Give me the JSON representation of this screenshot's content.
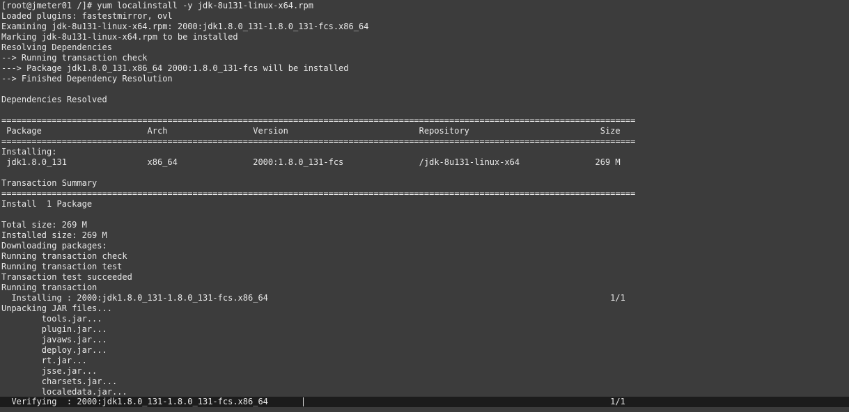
{
  "terminal": {
    "lines": [
      "[root@jmeter01 /]# yum localinstall -y jdk-8u131-linux-x64.rpm",
      "Loaded plugins: fastestmirror, ovl",
      "Examining jdk-8u131-linux-x64.rpm: 2000:jdk1.8.0_131-1.8.0_131-fcs.x86_64",
      "Marking jdk-8u131-linux-x64.rpm to be installed",
      "Resolving Dependencies",
      "--> Running transaction check",
      "---> Package jdk1.8.0_131.x86_64 2000:1.8.0_131-fcs will be installed",
      "--> Finished Dependency Resolution",
      "",
      "Dependencies Resolved",
      "",
      "==============================================================================================================================",
      " Package                     Arch                 Version                          Repository                          Size",
      "==============================================================================================================================",
      "Installing:",
      " jdk1.8.0_131                x86_64               2000:1.8.0_131-fcs               /jdk-8u131-linux-x64               269 M",
      "",
      "Transaction Summary",
      "==============================================================================================================================",
      "Install  1 Package",
      "",
      "Total size: 269 M",
      "Installed size: 269 M",
      "Downloading packages:",
      "Running transaction check",
      "Running transaction test",
      "Transaction test succeeded",
      "Running transaction",
      "  Installing : 2000:jdk1.8.0_131-1.8.0_131-fcs.x86_64                                                                    1/1",
      "Unpacking JAR files...",
      "        tools.jar...",
      "        plugin.jar...",
      "        javaws.jar...",
      "        deploy.jar...",
      "        rt.jar...",
      "        jsse.jar...",
      "        charsets.jar...",
      "        localedata.jar..."
    ],
    "current_line": "  Verifying  : 2000:jdk1.8.0_131-1.8.0_131-fcs.x86_64                                                                    1/1"
  }
}
